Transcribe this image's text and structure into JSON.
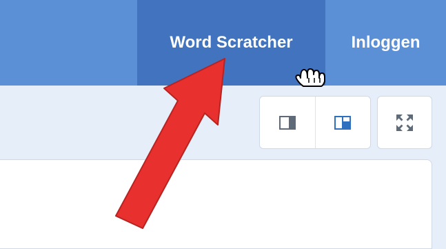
{
  "nav": {
    "word_scratcher_label": "Word Scratcher",
    "login_label": "Inloggen"
  },
  "toolbar": {
    "buttons": [
      {
        "icon": "panel-right-icon"
      },
      {
        "icon": "layout-split-icon"
      },
      {
        "icon": "fullscreen-expand-icon"
      }
    ]
  },
  "colors": {
    "topbar": "#5b8fd6",
    "nav_active": "#4173bf",
    "page_bg": "#e6eef9",
    "annotation_arrow": "#e8312f"
  }
}
